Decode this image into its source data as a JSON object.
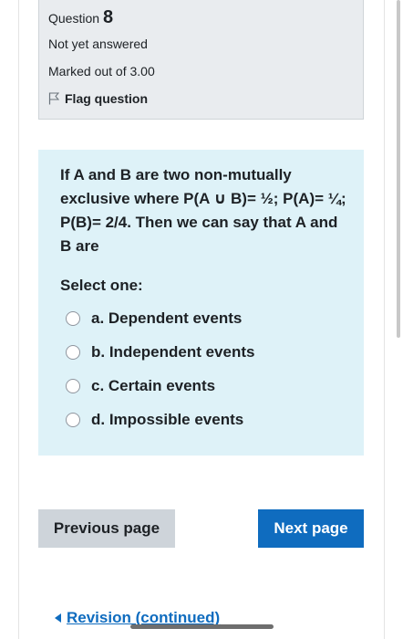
{
  "question_info": {
    "heading_prefix": "Question",
    "number": "8",
    "state": "Not yet answered",
    "grade": "Marked out of 3.00",
    "flag_label": "Flag question"
  },
  "question": {
    "text": "If A and B are two non-mutually exclusive where P(A ∪ B)= ½; P(A)= ¼; P(B)= 2/4. Then we can say that A and B are",
    "prompt": "Select one:",
    "answers": [
      {
        "label": "a. Dependent events"
      },
      {
        "label": "b. Independent events"
      },
      {
        "label": "c. Certain events"
      },
      {
        "label": "d. Impossible events"
      }
    ]
  },
  "navigation": {
    "previous_label": "Previous page",
    "next_label": "Next page",
    "back_link_label": "Revision (continued)"
  },
  "colors": {
    "info_bg": "#e9ecef",
    "content_bg": "#def2f8",
    "primary": "#0f6cbf",
    "secondary_btn": "#ced4da"
  },
  "icons": {
    "flag": "flag-icon",
    "back": "triangle-left-icon"
  }
}
